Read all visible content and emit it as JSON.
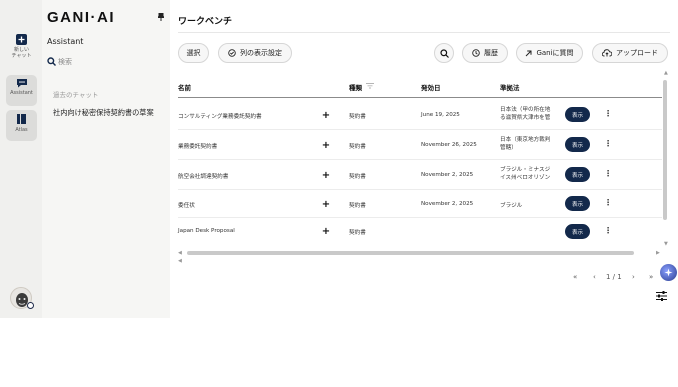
{
  "rail": {
    "new_chat": "新しい\nチャット",
    "assistant": "Assistant",
    "atlas": "Atlas"
  },
  "side": {
    "logo": "GANI·AI",
    "assistant_title": "Assistant",
    "search_placeholder": "検索",
    "past_chats_title": "過去のチャット",
    "chats": [
      "社内向け秘密保持契約書の草案"
    ]
  },
  "main": {
    "title": "ワークベンチ",
    "toolbar": {
      "select": "選択",
      "columns": "列の表示設定",
      "history": "履歴",
      "ask_gani": "Ganiに質問",
      "upload": "アップロード"
    },
    "table": {
      "headers": {
        "name": "名前",
        "type": "種類",
        "effective_date": "発効日",
        "governing_law": "準拠法"
      },
      "rows": [
        {
          "name": "コンサルティング業務委託契約書",
          "type": "契約書",
          "date": "June 19, 2025",
          "law": "日本法（甲の所在地\nる滋賀県大津市を管"
        },
        {
          "name": "業務委託契約書",
          "type": "契約書",
          "date": "November 26, 2025",
          "law": "日本（東京地方裁判\n管轄）"
        },
        {
          "name": "航空会社調達契約書",
          "type": "契約書",
          "date": "November 2, 2025",
          "law": "ブラジル・ミナスジ\nイス州ベロオリゾン"
        },
        {
          "name": "委任状",
          "type": "契約書",
          "date": "November 2, 2025",
          "law": "ブラジル"
        },
        {
          "name": "Japan Desk Proposal",
          "type": "契約書",
          "date": "",
          "law": ""
        }
      ],
      "show_label": "表示"
    },
    "pagination": {
      "first": "«",
      "prev": "‹",
      "page_info": "1 / 1",
      "next": "›",
      "last": "»"
    }
  }
}
